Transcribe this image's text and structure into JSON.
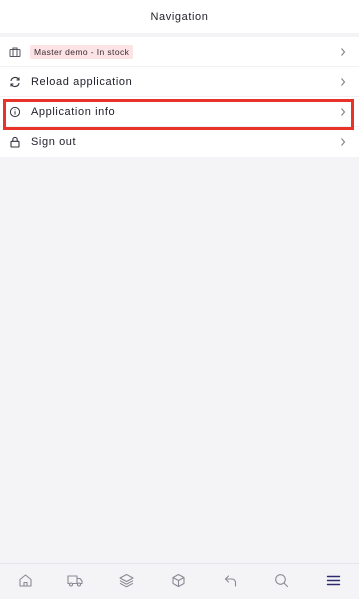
{
  "header": {
    "title": "Navigation"
  },
  "menu": {
    "items": [
      {
        "label": "Master demo - In stock",
        "icon": "briefcase-icon",
        "style": "badge"
      },
      {
        "label": "Reload application",
        "icon": "refresh-icon"
      },
      {
        "label": "Application info",
        "icon": "info-icon",
        "highlighted": true
      },
      {
        "label": "Sign out",
        "icon": "lock-icon"
      }
    ]
  },
  "bottom_nav": {
    "items": [
      {
        "icon": "home-icon"
      },
      {
        "icon": "truck-icon"
      },
      {
        "icon": "layers-icon"
      },
      {
        "icon": "box-icon"
      },
      {
        "icon": "return-icon"
      },
      {
        "icon": "search-icon"
      },
      {
        "icon": "menu-icon",
        "active": true
      }
    ],
    "active_color": "#2e2a6e",
    "inactive_color": "#8a8a94"
  },
  "colors": {
    "highlight_border": "#e8332a",
    "badge_background": "#fbe3e6"
  }
}
